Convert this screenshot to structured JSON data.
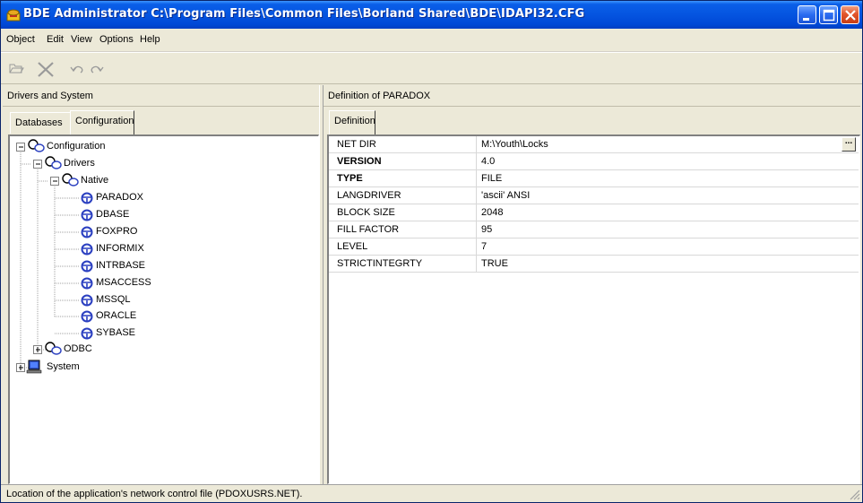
{
  "window": {
    "title": "BDE Administrator  C:\\Program Files\\Common Files\\Borland Shared\\BDE\\IDAPI32.CFG"
  },
  "menu": {
    "items": [
      {
        "label": "Object"
      },
      {
        "label": "Edit"
      },
      {
        "label": "View"
      },
      {
        "label": "Options"
      },
      {
        "label": "Help"
      }
    ]
  },
  "toolbar": {
    "icons": [
      "open-icon",
      "delete-icon",
      "undo-icon",
      "redo-icon"
    ]
  },
  "left_panel": {
    "header": "Drivers and System",
    "tabs": [
      {
        "label": "Databases"
      },
      {
        "label": "Configuration"
      }
    ],
    "tree": {
      "root": "Configuration",
      "drivers": "Drivers",
      "native": "Native",
      "native_items": [
        "PARADOX",
        "DBASE",
        "FOXPRO",
        "INFORMIX",
        "INTRBASE",
        "MSACCESS",
        "MSSQL",
        "ORACLE",
        "SYBASE"
      ],
      "odbc": "ODBC",
      "system": "System"
    }
  },
  "right_panel": {
    "header": "Definition of PARADOX",
    "tab": "Definition",
    "rows": [
      {
        "name": "NET DIR",
        "value": "M:\\Youth\\Locks",
        "bold": false
      },
      {
        "name": "VERSION",
        "value": "4.0",
        "bold": true
      },
      {
        "name": "TYPE",
        "value": "FILE",
        "bold": true
      },
      {
        "name": "LANGDRIVER",
        "value": "'ascii' ANSI",
        "bold": false
      },
      {
        "name": "BLOCK SIZE",
        "value": "2048",
        "bold": false
      },
      {
        "name": "FILL FACTOR",
        "value": "95",
        "bold": false
      },
      {
        "name": "LEVEL",
        "value": "7",
        "bold": false
      },
      {
        "name": "STRICTINTEGRTY",
        "value": "TRUE",
        "bold": false
      }
    ],
    "ellipsis": "..."
  },
  "status": {
    "text": "Location of the application's network control file (PDOXUSRS.NET)."
  },
  "colors": {
    "titlebar": "#0554e0",
    "face": "#ece9d8",
    "close_button": "#e2562c",
    "driver_icon": "#2a3fc0"
  }
}
